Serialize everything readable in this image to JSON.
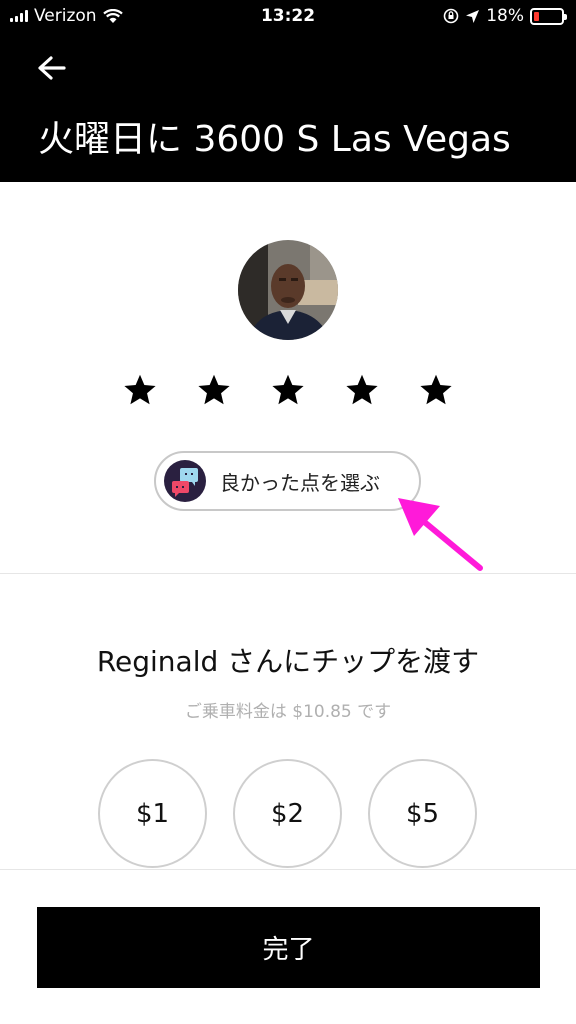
{
  "status_bar": {
    "carrier": "Verizon",
    "time": "13:22",
    "battery_percent": "18%",
    "battery_level": 0.18
  },
  "header": {
    "title": "火曜日に 3600 S Las Vegas"
  },
  "rating": {
    "stars_filled": 5,
    "stars_total": 5
  },
  "compliment": {
    "label": "良かった点を選ぶ"
  },
  "tip_section": {
    "title": "Reginald さんにチップを渡す",
    "fare_note": "ご乗車料金は $10.85 です",
    "options": [
      "$1",
      "$2",
      "$5"
    ]
  },
  "footer": {
    "done_label": "完了"
  },
  "colors": {
    "header_bg": "#000000",
    "accent_arrow": "#ff1ad9",
    "battery_low": "#ff3b30"
  }
}
